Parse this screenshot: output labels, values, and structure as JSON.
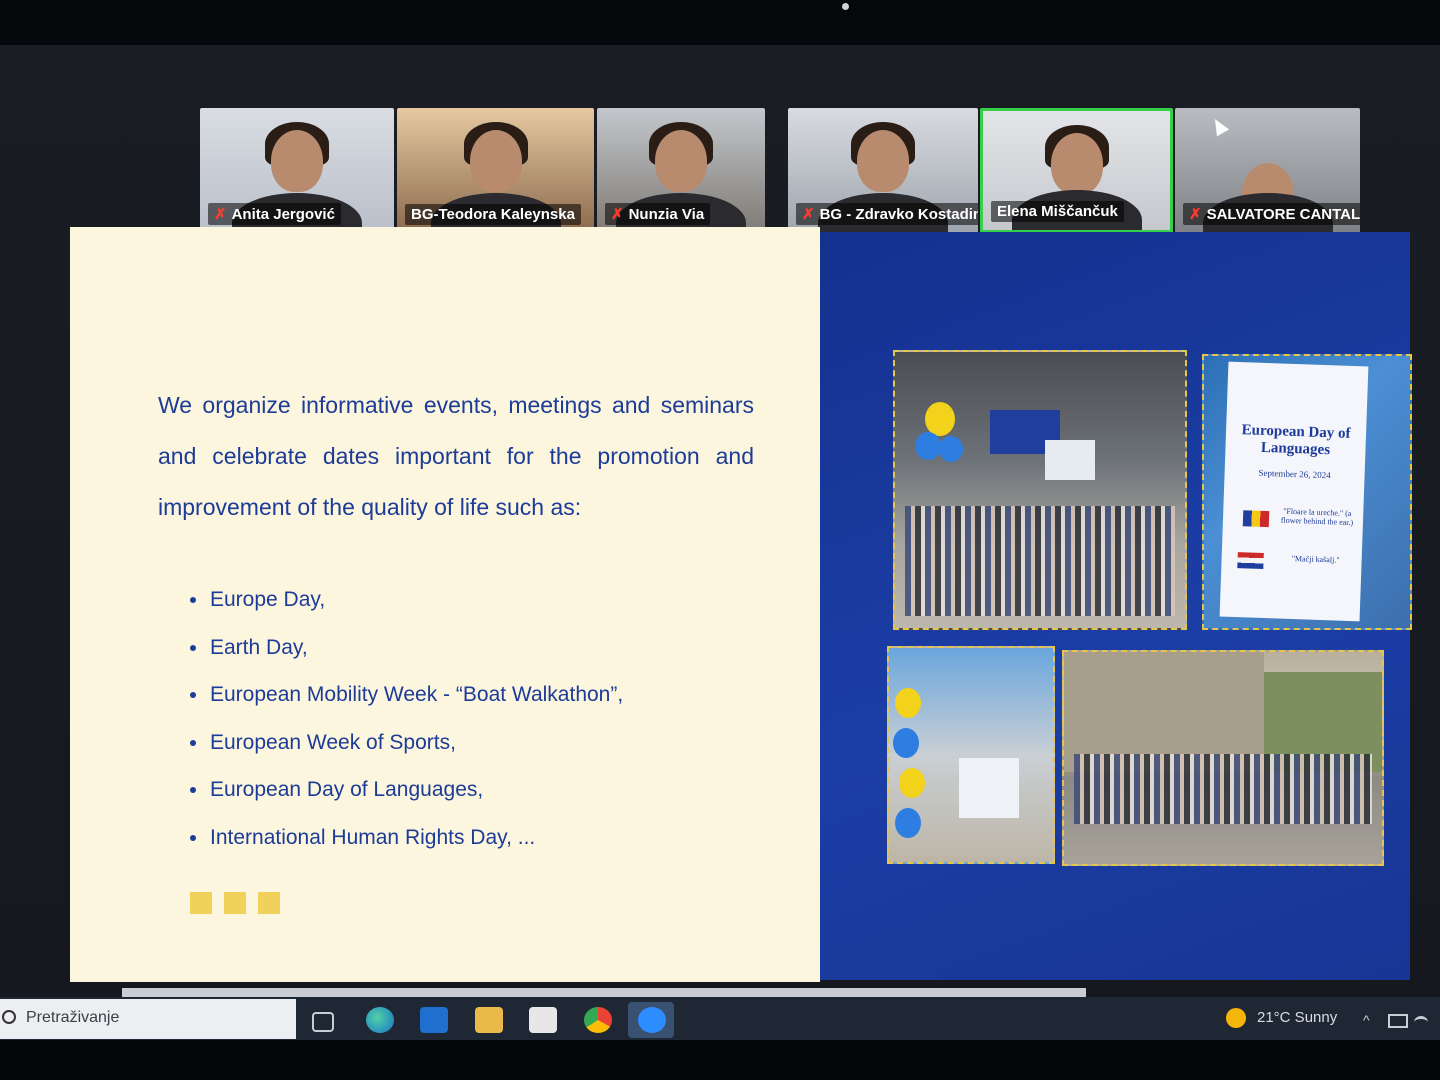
{
  "participants": [
    {
      "name": "Anita Jergović",
      "muted": true
    },
    {
      "name": "BG-Teodora Kaleynska",
      "muted": false
    },
    {
      "name": "Nunzia Via",
      "muted": true
    },
    {
      "name": "BG - Zdravko Kostadin...",
      "muted": true
    },
    {
      "name": "Elena Miščančuk",
      "muted": false,
      "active_speaker": true
    },
    {
      "name": "SALVATORE CANTALIN...",
      "muted": true
    }
  ],
  "slide": {
    "paragraph": "We organize informative events, meetings and seminars and celebrate dates important for the promotion and improvement of the quality of life such as:",
    "bullets": [
      "Europe Day,",
      "Earth Day,",
      "European Mobility Week - “Boat Walkathon”,",
      "European Week of Sports,",
      "European Day of Languages,",
      "International Human Rights Day, ..."
    ],
    "flyer": {
      "title": "European Day of Languages",
      "date": "September 26, 2024",
      "quote_ro": "\"Floare la ureche.\" (a flower behind the ear.)",
      "quote_hr": "\"Mačji kašalj.\""
    },
    "colors": {
      "left_bg": "#fbf6dd",
      "right_bg": "#1b3ea6",
      "text": "#1d3b98",
      "accent": "#f0d25a"
    }
  },
  "taskbar": {
    "search_placeholder": "Pretraživanje",
    "weather": "21°C  Sunny",
    "icons": [
      "task-view-icon",
      "edge-icon",
      "outlook-icon",
      "file-explorer-icon",
      "store-icon",
      "chrome-icon",
      "zoom-icon"
    ]
  }
}
